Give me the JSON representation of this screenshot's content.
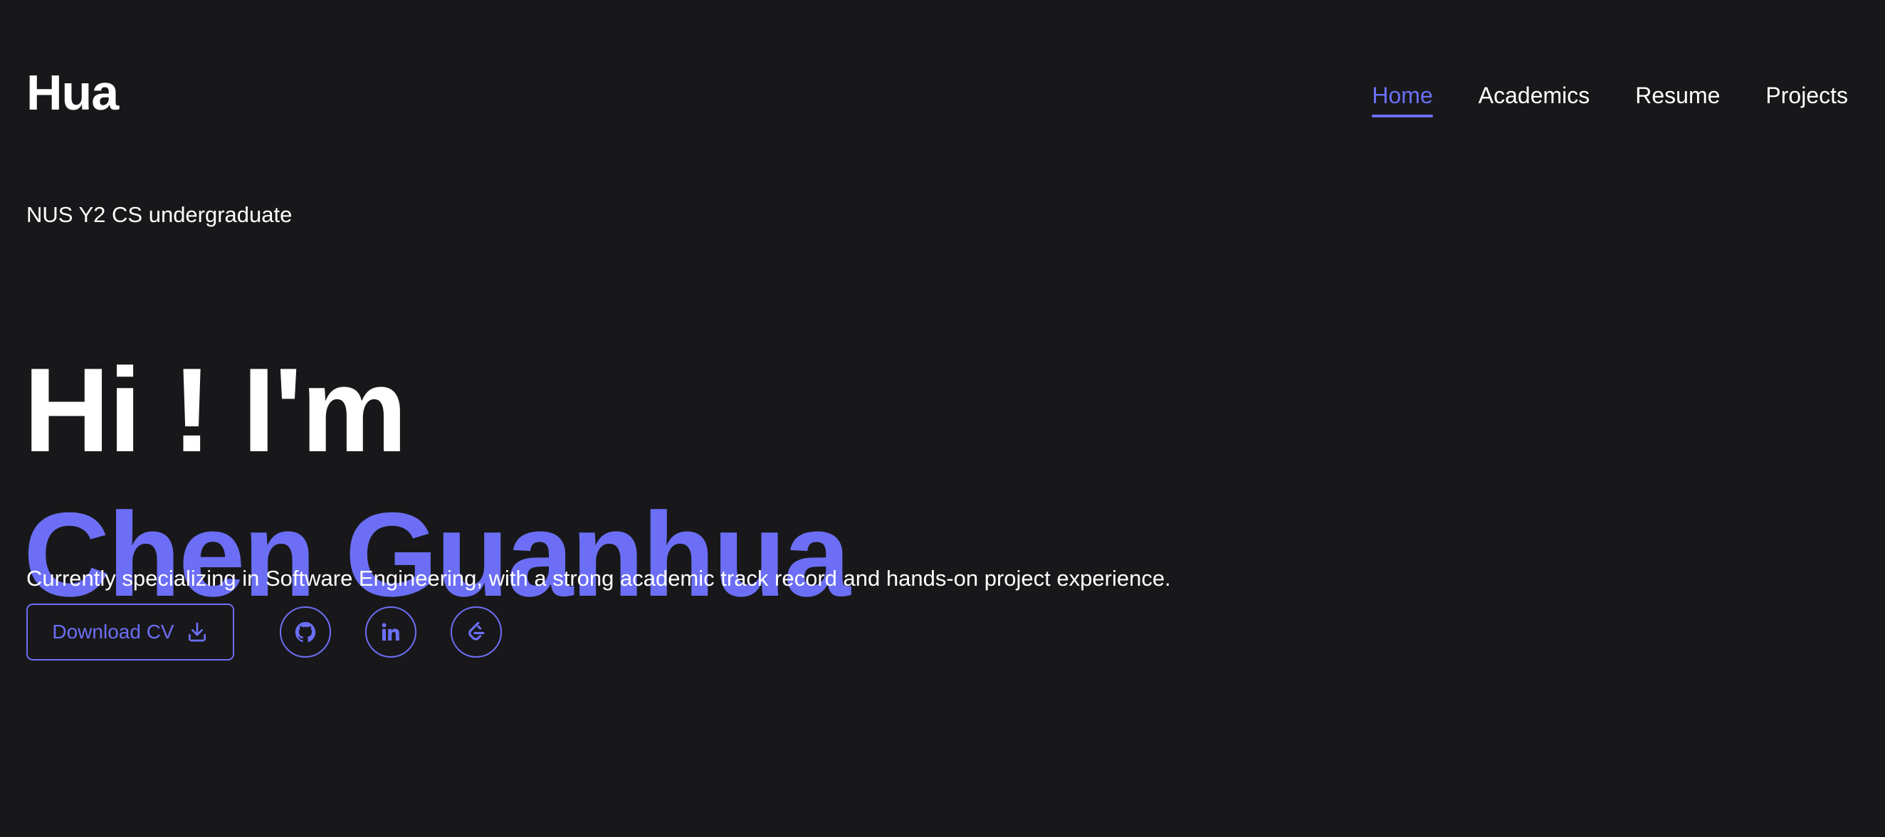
{
  "header": {
    "logo": "Hua",
    "nav": [
      {
        "label": "Home",
        "active": true
      },
      {
        "label": "Academics",
        "active": false
      },
      {
        "label": "Resume",
        "active": false
      },
      {
        "label": "Projects",
        "active": false
      }
    ]
  },
  "hero": {
    "subtitle": "NUS Y2 CS undergraduate",
    "greeting": "Hi ! I'm",
    "name": "Chen Guanhua",
    "description": "Currently specializing in Software Engineering, with a strong academic track record and hands-on project experience."
  },
  "actions": {
    "download_label": "Download CV",
    "download_icon": "download-icon",
    "socials": [
      {
        "icon": "github-icon"
      },
      {
        "icon": "linkedin-icon"
      },
      {
        "icon": "leetcode-icon"
      }
    ]
  },
  "colors": {
    "background": "#18181a",
    "accent": "#6c6ff5",
    "text": "#ffffff"
  }
}
